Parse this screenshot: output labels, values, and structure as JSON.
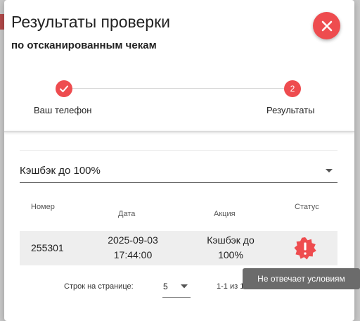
{
  "dialog": {
    "title": "Результаты проверки",
    "subtitle": "по отсканированным чекам",
    "close_icon": "close-icon"
  },
  "stepper": {
    "steps": [
      {
        "label": "Ваш телефон",
        "state": "completed",
        "icon": "check-icon"
      },
      {
        "label": "Результаты",
        "number": "2",
        "state": "active"
      }
    ]
  },
  "filter": {
    "selected": "Кэшбэк до 100%",
    "icon": "chevron-down-icon"
  },
  "table": {
    "headers": {
      "number": "Номер",
      "date": "Дата",
      "promo": "Акция",
      "status": "Статус"
    },
    "rows": [
      {
        "number": "255301",
        "date_day": "2025-09-03",
        "date_time": "17:44:00",
        "promo_line1": "Кэшбэк до",
        "promo_line2": "100%",
        "status_icon": "warning-badge-icon"
      }
    ]
  },
  "pagination": {
    "rows_label": "Строк на странице:",
    "rows_value": "5",
    "range_text": "1-1 из 1"
  },
  "tooltip": {
    "text": "Не отвечает условиям"
  },
  "colors": {
    "accent": "#ee4c4f",
    "row_bg": "#eeeeee",
    "tooltip_bg": "#6b6b6b"
  }
}
